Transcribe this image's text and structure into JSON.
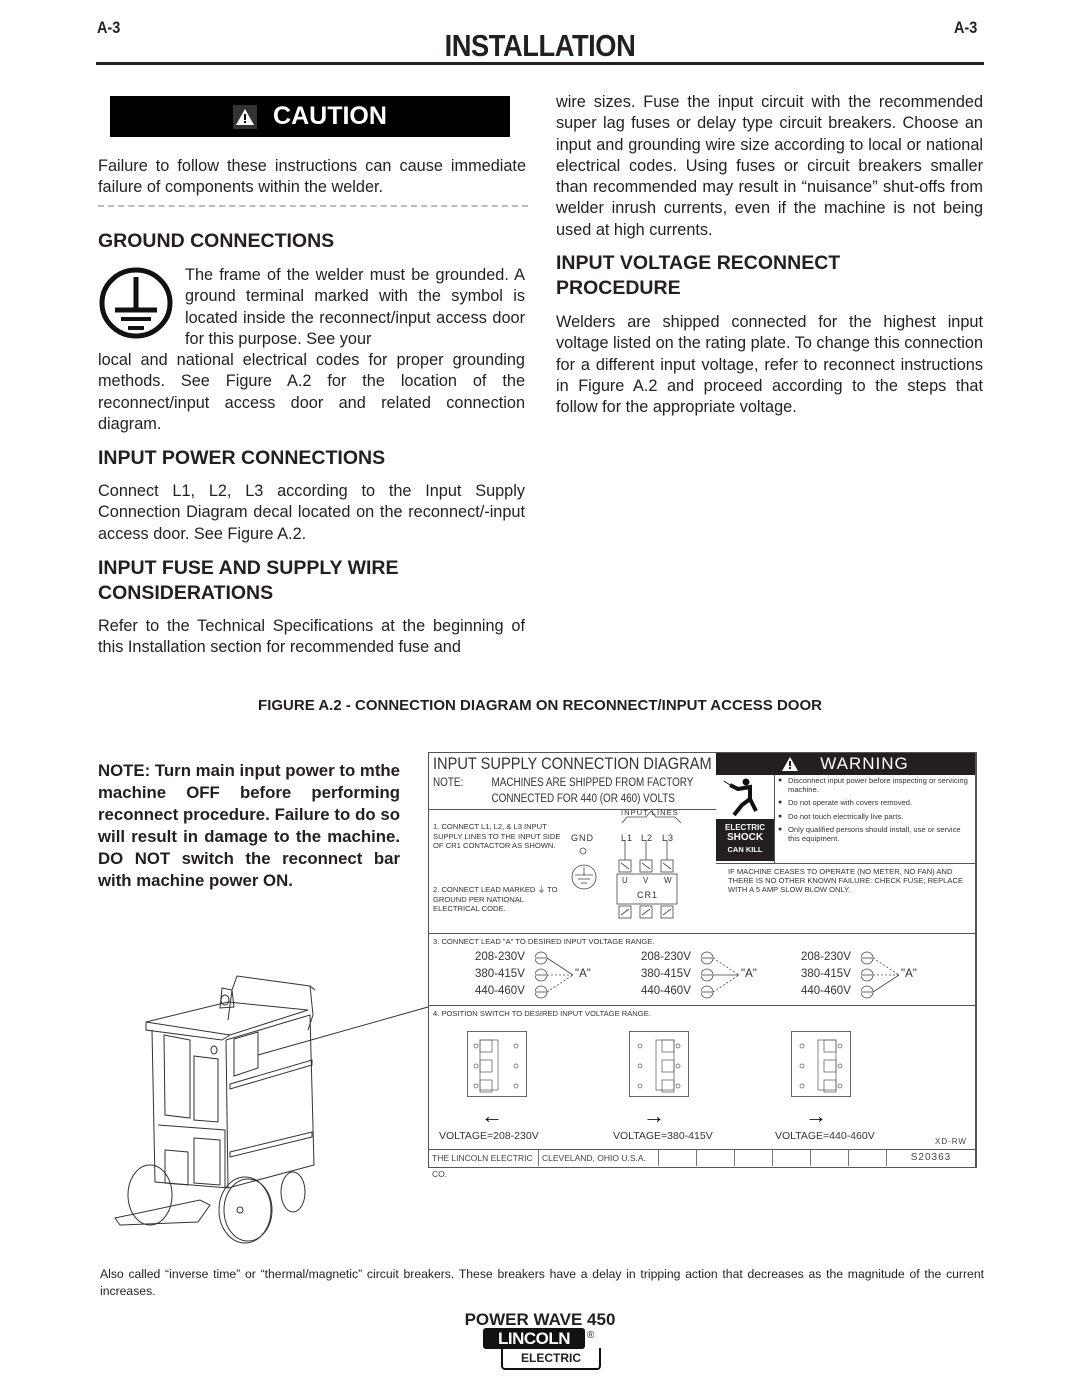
{
  "header": {
    "page_left": "A-3",
    "page_right": "A-3",
    "section_title": "INSTALLATION"
  },
  "caution": {
    "label": "CAUTION",
    "icon": "warning-triangle-icon",
    "text": "Failure to follow these instructions can cause immediate failure of components within the welder."
  },
  "sections": {
    "ground": {
      "heading": "GROUND CONNECTIONS",
      "icon": "protective-earth-ground-icon",
      "text_wrapped": "The frame of the welder must be grounded. A ground terminal marked with the symbol is located inside the reconnect/input access door for this purpose. See your",
      "text_rest": "local and national electrical codes for proper grounding methods.  See Figure A.2 for the location of the reconnect/input access door and related connection diagram."
    },
    "input_power": {
      "heading": "INPUT POWER CONNECTIONS",
      "text": "Connect L1, L2, L3 according to the Input Supply Connection Diagram decal located on the reconnect/-input access door.  See Figure A.2."
    },
    "input_fuse": {
      "heading": "INPUT FUSE AND SUPPLY WIRE CONSIDERATIONS",
      "text": "Refer to the Technical Specifications at the beginning of this Installation section for recommended fuse and",
      "text_continued": "wire sizes.  Fuse the input circuit with the recommended super lag fuses or delay type circuit breakers. Choose an input and grounding wire size according to local or national electrical codes.  Using fuses or circuit breakers smaller than recommended may result in “nuisance” shut-offs from welder inrush currents, even if the machine is not being used at high currents."
    },
    "reconnect": {
      "heading": "INPUT VOLTAGE RECONNECT PROCEDURE",
      "text": "Welders are shipped connected for the highest input voltage listed on the rating plate.  To change this connection for a different input voltage, refer to reconnect instructions in Figure A.2 and proceed according to the steps that follow for the appropriate voltage."
    }
  },
  "figure": {
    "caption": "FIGURE A.2 - CONNECTION DIAGRAM ON RECONNECT/INPUT ACCESS DOOR",
    "note": "NOTE: Turn main input power to mthe machine OFF before performing reconnect procedure.  Failure to do so will result in damage to the machine.  DO NOT switch the reconnect bar with machine power ON.",
    "decal": {
      "title": "INPUT SUPPLY CONNECTION DIAGRAM",
      "note_label": "NOTE:",
      "note_line1": "MACHINES ARE SHIPPED FROM FACTORY",
      "note_line2": "CONNECTED FOR 440 (OR 460) VOLTS",
      "step1": "1. CONNECT L1, L2, & L3 INPUT SUPPLY LINES TO THE INPUT SIDE OF CR1 CONTACTOR AS SHOWN.",
      "step2": "2. CONNECT LEAD MARKED ⏚ TO GROUND PER NATIONAL ELECTRICAL CODE.",
      "step3": "3. CONNECT LEAD \"A\" TO DESIRED INPUT VOLTAGE RANGE.",
      "step4": "4. POSITION SWITCH TO DESIRED INPUT VOLTAGE RANGE.",
      "input_lines_label": "INPUT LINES",
      "gnd_label": "GND",
      "lines": [
        "L1",
        "L2",
        "L3"
      ],
      "terminals": [
        "U",
        "V",
        "W"
      ],
      "contactor": "CR1",
      "lead_label": "\"A\"",
      "voltage_ranges": [
        "208-230V",
        "380-415V",
        "440-460V"
      ],
      "switch_labels": [
        "VOLTAGE=208-230V",
        "VOLTAGE=380-415V",
        "VOLTAGE=440-460V"
      ],
      "switch_directions": [
        "left",
        "right",
        "right"
      ],
      "drawing_code": "XD-RW",
      "company": "THE LINCOLN ELECTRIC CO.",
      "city": "CLEVELAND, OHIO  U.S.A.",
      "part_number": "S20363"
    },
    "warning": {
      "label": "WARNING",
      "side_line1": "ELECTRIC",
      "side_line2": "SHOCK",
      "side_line3": "CAN KILL",
      "items": [
        "Disconnect input power before inspecting or servicing machine.",
        "Do not operate with covers removed.",
        "Do not touch electrically live parts.",
        "Only qualified persons should install, use or service this equipment."
      ],
      "footer": "IF MACHINE CEASES TO OPERATE (NO METER, NO FAN) AND THERE IS NO OTHER KNOWN FAILURE: CHECK FUSE; REPLACE WITH A 5 AMP SLOW BLOW ONLY."
    }
  },
  "footnote": "Also called “inverse time” or “thermal/magnetic” circuit breakers.  These breakers have a delay in tripping action that decreases as the magnitude of the current increases.",
  "footer": {
    "product": "POWER WAVE 450",
    "logo_top": "LINCOLN",
    "logo_bottom": "ELECTRIC",
    "registered": "®"
  }
}
